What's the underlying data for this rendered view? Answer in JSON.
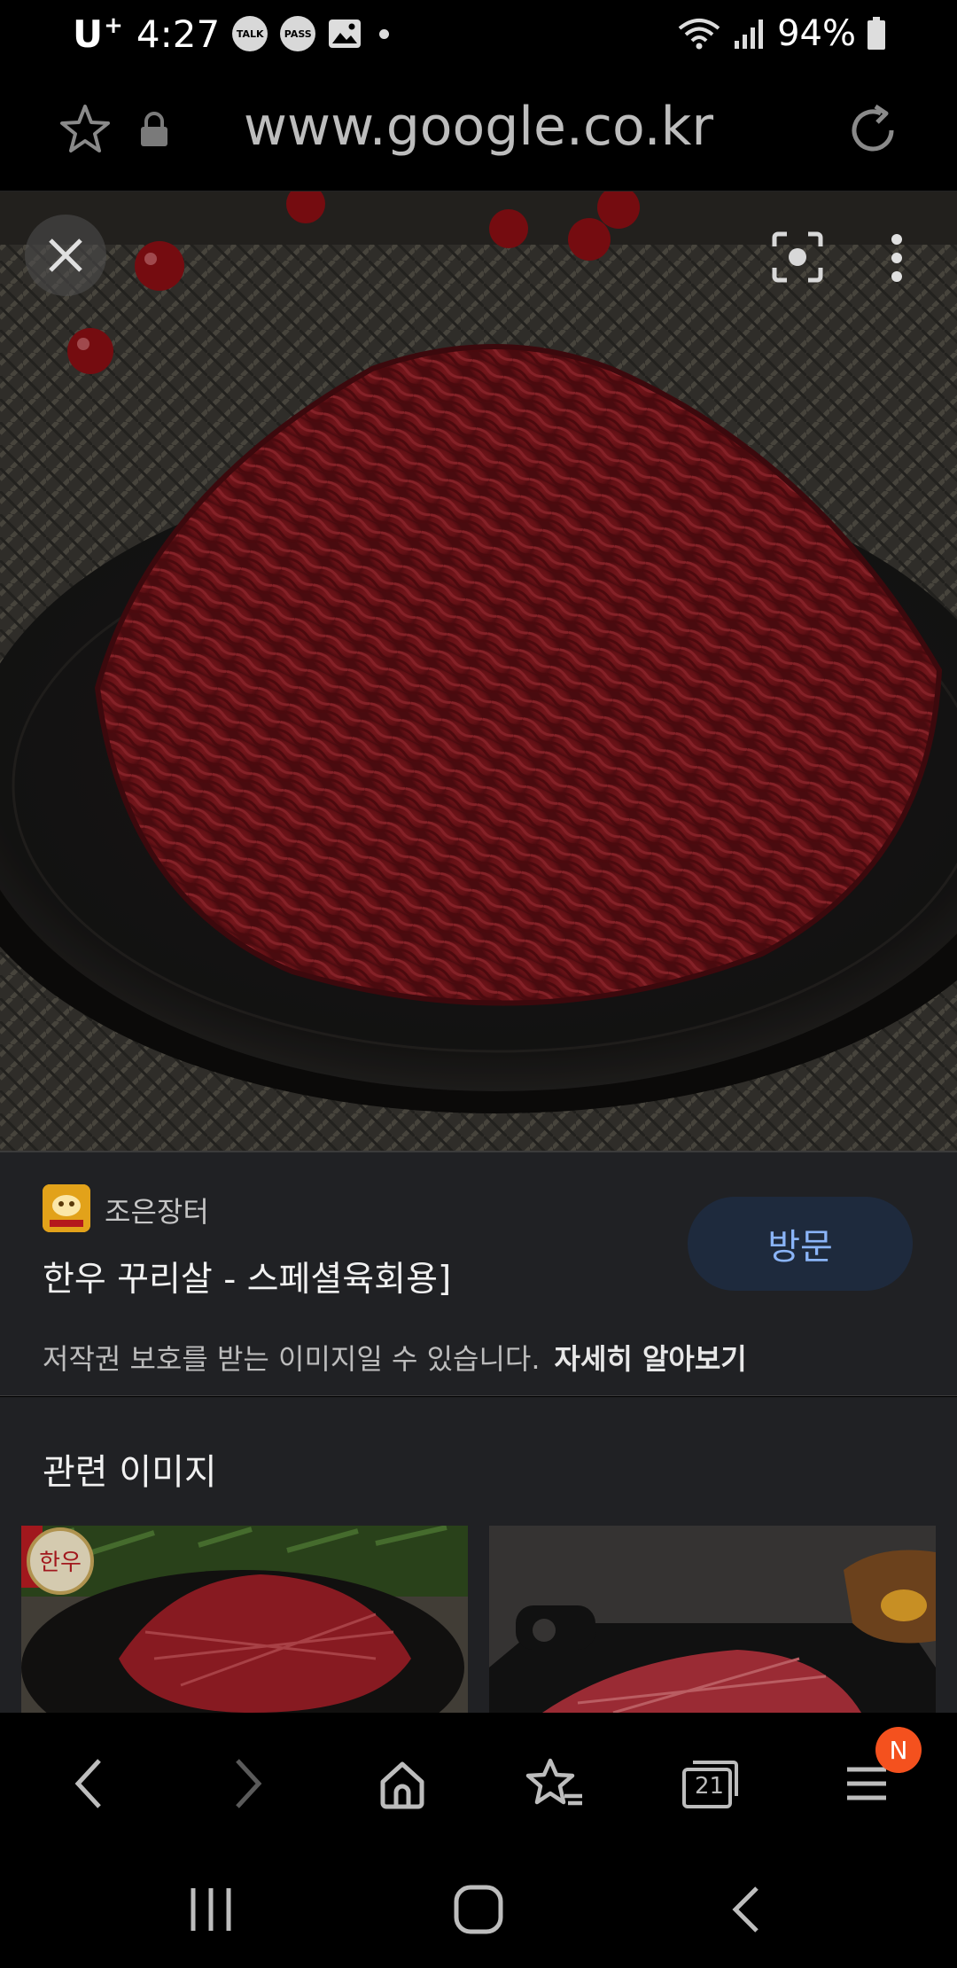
{
  "status_bar": {
    "carrier": "U",
    "carrier_sup": "+",
    "time": "4:27",
    "badge_talk": "TALK",
    "badge_pass": "PASS",
    "battery": "94%"
  },
  "address_bar": {
    "url": "www.google.co.kr"
  },
  "result": {
    "source_name": "조은장터",
    "title": "한우 꾸리살 - 스페셜육회용]",
    "visit_label": "방문",
    "copyright_text": "저작권 보호를 받는 이미지일 수 있습니다.",
    "learn_more": "자세히 알아보기"
  },
  "related": {
    "heading": "관련 이미지",
    "thumb1_stamp": "한우"
  },
  "toolbar": {
    "tabs_count": "21",
    "menu_badge": "N"
  },
  "icons": [
    "star-icon",
    "lock-icon",
    "reload-icon",
    "close-icon",
    "lens-icon",
    "more-vert-icon",
    "back-icon",
    "forward-icon",
    "home-icon",
    "bookmarks-icon",
    "tabs-icon",
    "menu-icon",
    "recent-apps-icon",
    "home-circle-icon",
    "system-back-icon"
  ],
  "colors": {
    "link_blue": "#8ab4f8",
    "panel_bg": "#202124",
    "badge_orange": "#f4511e"
  }
}
